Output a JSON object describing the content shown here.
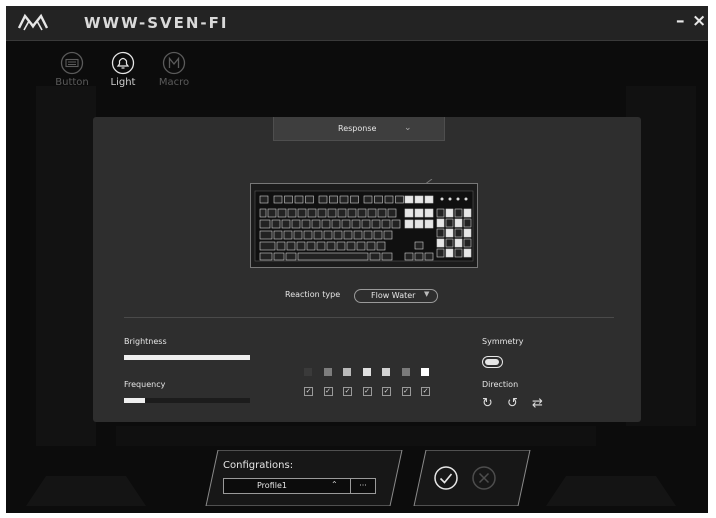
{
  "window": {
    "brand": "WWW-SVEN-FI",
    "minimize_label": "–",
    "close_label": "×"
  },
  "tabs": [
    {
      "label": "Button",
      "icon": "keyboard-icon",
      "active": false
    },
    {
      "label": "Light",
      "icon": "bell-icon",
      "active": true
    },
    {
      "label": "Macro",
      "icon": "macro-m-icon",
      "active": false
    }
  ],
  "panel": {
    "response": {
      "label": "Response",
      "chevron": "⌄"
    },
    "reaction_type": {
      "label": "Reaction type",
      "value": "Flow Water",
      "arrow": "▼"
    },
    "brightness": {
      "label": "Brightness",
      "level": 1.0
    },
    "frequency": {
      "label": "Frequency",
      "level": 0.17
    },
    "colors": [
      "#3a3a3a",
      "#7d7d7d",
      "#b9b9b9",
      "#e0e0e0",
      "#d2d2d2",
      "#7a7a7a",
      "#ffffff"
    ],
    "color_checked": [
      true,
      true,
      true,
      true,
      true,
      true,
      true
    ],
    "check_mark": "☑",
    "symmetry": {
      "label": "Symmetry",
      "on": true
    },
    "direction": {
      "label": "Direction",
      "options": [
        "↻",
        "↺",
        "⇄"
      ]
    }
  },
  "configurations": {
    "label": "Configrations:",
    "profile": "Profile1",
    "chevron": "⌃",
    "more": "···"
  },
  "actions": {
    "confirm_icon": "check-circle-icon",
    "cancel_icon": "x-circle-icon"
  },
  "accent": "#efefef"
}
